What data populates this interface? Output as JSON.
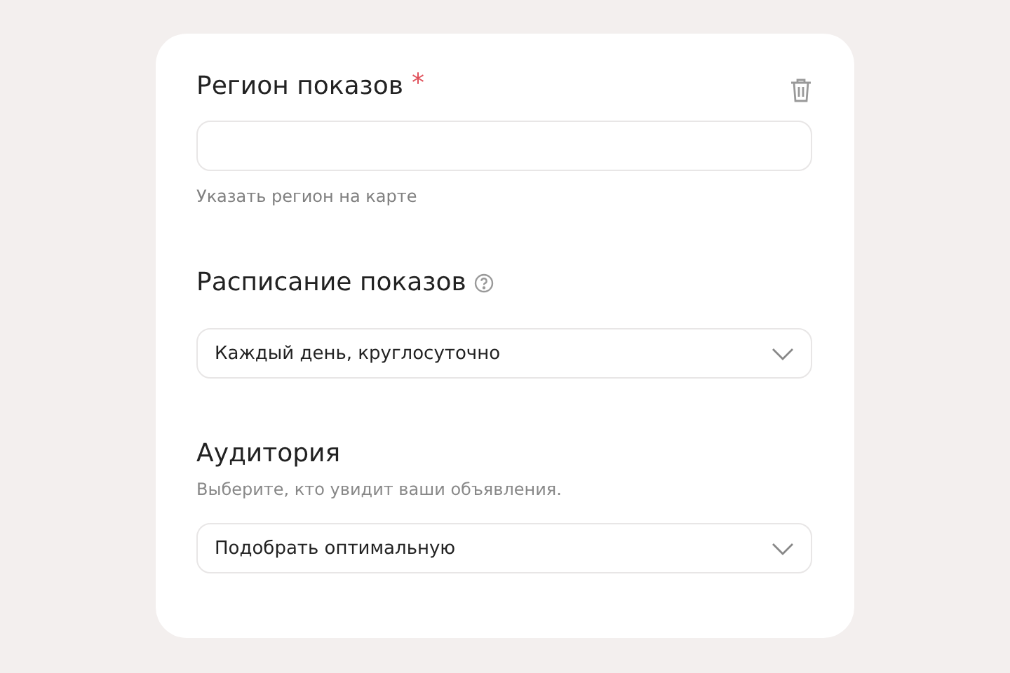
{
  "region": {
    "title": "Регион показов",
    "required_mark": "*",
    "hint_link": "Указать регион на карте"
  },
  "schedule": {
    "title": "Расписание показов",
    "select_value": "Каждый день, круглосуточно"
  },
  "audience": {
    "title": "Аудитория",
    "description": "Выберите, кто увидит ваши объявления.",
    "select_value": "Подобрать оптимальную"
  }
}
